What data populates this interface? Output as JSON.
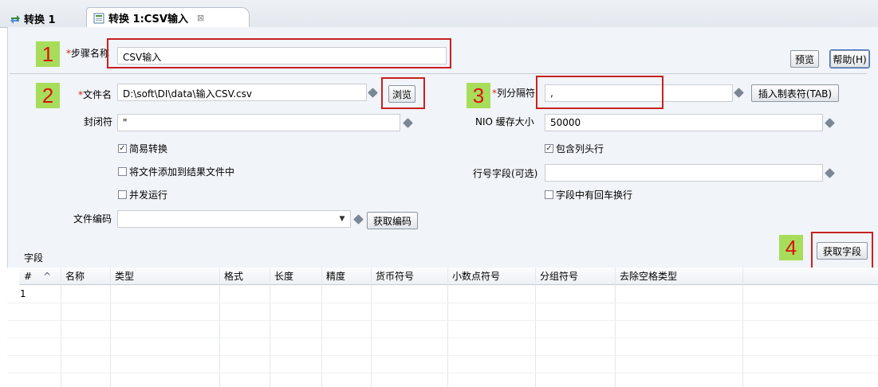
{
  "tabs": [
    {
      "label": "转换 1"
    },
    {
      "label": "转换 1:CSV输入",
      "close": "⊠"
    }
  ],
  "step": {
    "label": "步骤名称",
    "value": "CSV输入"
  },
  "buttons": {
    "preview": "预览",
    "help": "帮助(H)",
    "browse": "浏览",
    "insert_tab": "插入制表符(TAB)",
    "get_encoding": "获取编码",
    "get_fields": "获取字段"
  },
  "form": {
    "filename": {
      "label": "文件名",
      "value": "D:\\soft\\DI\\data\\输入CSV.csv"
    },
    "enclosure": {
      "label": "封闭符",
      "value": "\""
    },
    "delimiter": {
      "label": "列分隔符",
      "value": ","
    },
    "nio": {
      "label": "NIO 缓存大小",
      "value": "50000"
    },
    "row_field": {
      "label": "行号字段(可选)",
      "value": ""
    },
    "encoding": {
      "label": "文件编码",
      "value": ""
    }
  },
  "checkboxes": {
    "lazy": {
      "label": "简易转换",
      "checked": true
    },
    "add_result": {
      "label": "将文件添加到结果文件中",
      "checked": false
    },
    "parallel": {
      "label": "并发运行",
      "checked": false
    },
    "header": {
      "label": "包含列头行",
      "checked": true
    },
    "newline": {
      "label": "字段中有回车换行",
      "checked": false
    }
  },
  "markers": [
    "1",
    "2",
    "3",
    "4"
  ],
  "fields_section_label": "字段",
  "table": {
    "columns": [
      "#",
      "名称",
      "类型",
      "格式",
      "长度",
      "精度",
      "货币符号",
      "小数点符号",
      "分组符号",
      "去除空格类型"
    ],
    "sort_indicator": "^",
    "rows": [
      [
        "1"
      ]
    ]
  },
  "colors": {
    "marker_bg": "#a7dd5a",
    "marker_text": "#d11",
    "highlight": "#c92121"
  }
}
